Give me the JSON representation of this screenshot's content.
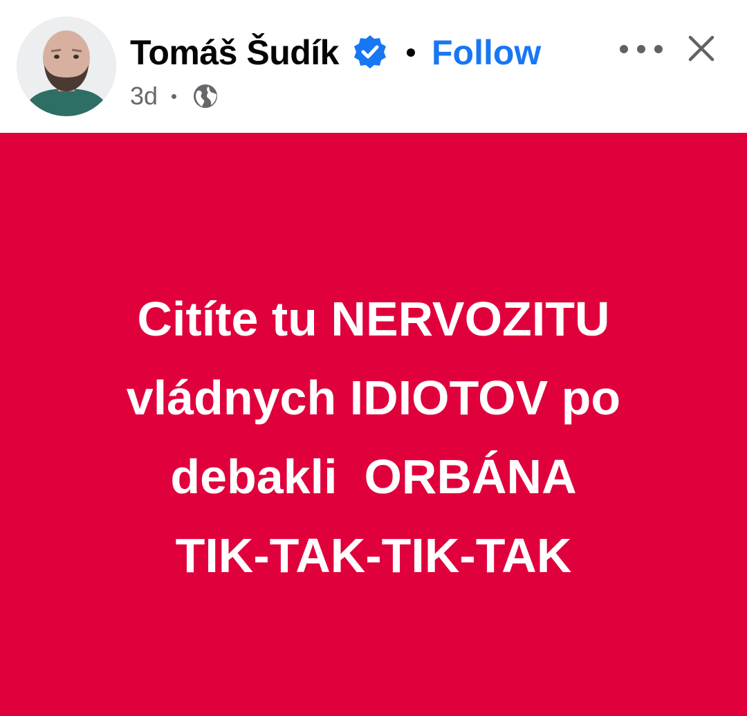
{
  "colors": {
    "post_background": "#e0003c",
    "post_text": "#ffffff",
    "follow_link": "#1877f2",
    "verified_badge": "#1877f2",
    "secondary_text": "#65676b"
  },
  "author": {
    "name": "Tomáš Šudík",
    "avatar_icon": "profile-photo",
    "verified_icon": "verified-badge-icon",
    "follow_label": "Follow"
  },
  "meta": {
    "timestamp": "3d",
    "audience_icon": "globe-icon"
  },
  "actions": {
    "more_icon": "more-options-icon",
    "close_icon": "close-icon"
  },
  "post": {
    "lines": [
      "Citíte tu NERVOZITU",
      "vládnych IDIOTOV po",
      "debakli  ORBÁNA",
      "TIK-TAK-TIK-TAK"
    ]
  }
}
